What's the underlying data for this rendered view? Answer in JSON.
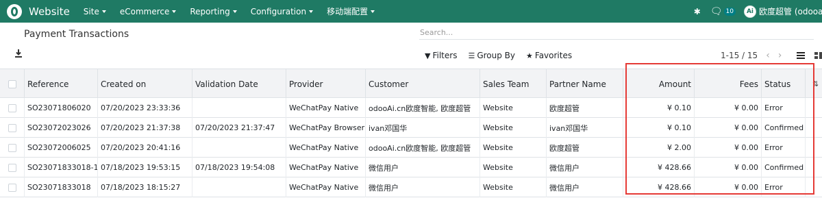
{
  "navbar": {
    "app_title": "Website",
    "menu": [
      "Site",
      "eCommerce",
      "Reporting",
      "Configuration",
      "移动端配置"
    ],
    "chat_count": "10",
    "avatar_initials": "Ai",
    "username": "欧度超管 (odooai.cn)"
  },
  "page": {
    "breadcrumb": "Payment Transactions",
    "search_placeholder": "Search...",
    "filters_label": "Filters",
    "group_by_label": "Group By",
    "favorites_label": "Favorites",
    "pager": "1-15 / 15"
  },
  "table": {
    "headers": {
      "reference": "Reference",
      "created_on": "Created on",
      "validation_date": "Validation Date",
      "provider": "Provider",
      "customer": "Customer",
      "sales_team": "Sales Team",
      "partner_name": "Partner Name",
      "amount": "Amount",
      "fees": "Fees",
      "status": "Status"
    },
    "rows": [
      {
        "reference": "SO23071806020",
        "created_on": "07/20/2023 23:33:36",
        "validation_date": "",
        "provider": "WeChatPay Native",
        "customer": "odooAi.cn欧度智能, 欧度超管",
        "sales_team": "Website",
        "partner_name": "欧度超管",
        "amount": "¥ 0.10",
        "fees": "¥ 0.00",
        "status": "Error"
      },
      {
        "reference": "SO23072023026",
        "created_on": "07/20/2023 21:37:38",
        "validation_date": "07/20/2023 21:37:47",
        "provider": "WeChatPay Browser",
        "customer": "ivan邓国华",
        "sales_team": "Website",
        "partner_name": "ivan邓国华",
        "amount": "¥ 0.10",
        "fees": "¥ 0.00",
        "status": "Confirmed"
      },
      {
        "reference": "SO23072006025",
        "created_on": "07/20/2023 20:41:16",
        "validation_date": "",
        "provider": "WeChatPay Native",
        "customer": "odooAi.cn欧度智能, 欧度超管",
        "sales_team": "Website",
        "partner_name": "欧度超管",
        "amount": "¥ 2.00",
        "fees": "¥ 0.00",
        "status": "Error"
      },
      {
        "reference": "SO23071833018-1",
        "created_on": "07/18/2023 19:53:15",
        "validation_date": "07/18/2023 19:54:08",
        "provider": "WeChatPay Native",
        "customer": "微信用户",
        "sales_team": "Website",
        "partner_name": "微信用户",
        "amount": "¥ 428.66",
        "fees": "¥ 0.00",
        "status": "Confirmed"
      },
      {
        "reference": "SO23071833018",
        "created_on": "07/18/2023 18:15:27",
        "validation_date": "",
        "provider": "WeChatPay Native",
        "customer": "微信用户",
        "sales_team": "Website",
        "partner_name": "微信用户",
        "amount": "¥ 428.66",
        "fees": "¥ 0.00",
        "status": "Error"
      }
    ]
  },
  "colors": {
    "navbar_bg": "#1f7a64",
    "highlight_border": "#e53935",
    "header_bg": "#f2f3f5"
  }
}
